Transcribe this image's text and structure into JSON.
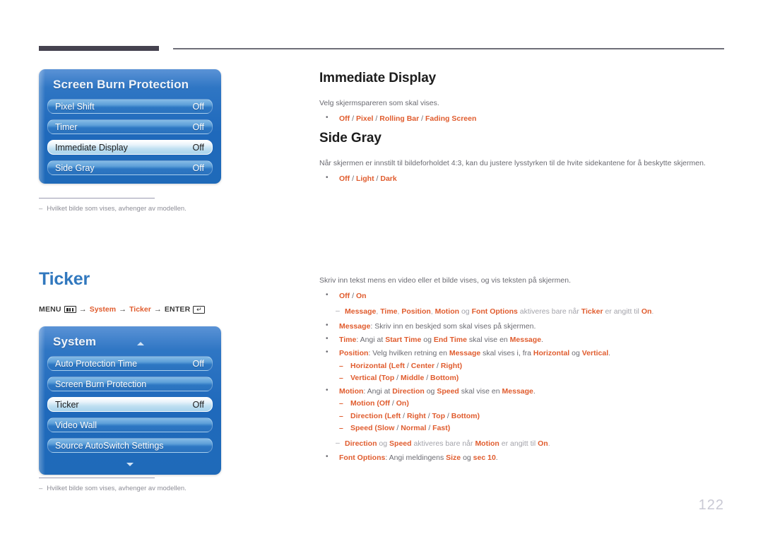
{
  "page": {
    "number": "122"
  },
  "panels": {
    "screen_burn_protection": {
      "title": "Screen Burn Protection",
      "rows": [
        {
          "label": "Pixel Shift",
          "value": "Off",
          "selected": false
        },
        {
          "label": "Timer",
          "value": "Off",
          "selected": false
        },
        {
          "label": "Immediate Display",
          "value": "Off",
          "selected": true
        },
        {
          "label": "Side Gray",
          "value": "Off",
          "selected": false
        }
      ]
    },
    "system": {
      "title": "System",
      "rows": [
        {
          "label": "Auto Protection Time",
          "value": "Off",
          "selected": false
        },
        {
          "label": "Screen Burn Protection",
          "value": "",
          "selected": false
        },
        {
          "label": "Ticker",
          "value": "Off",
          "selected": true
        },
        {
          "label": "Video Wall",
          "value": "",
          "selected": false
        },
        {
          "label": "Source AutoSwitch Settings",
          "value": "",
          "selected": false
        }
      ]
    }
  },
  "footnotes": {
    "one": "Hvilket bilde som vises, avhenger av modellen.",
    "two": "Hvilket bilde som vises, avhenger av modellen.",
    "dash": "–"
  },
  "sections": {
    "immediate_display": {
      "heading": "Immediate Display",
      "description": "Velg skjermspareren som skal vises.",
      "options": {
        "a": "Off",
        "s1": " / ",
        "b": "Pixel",
        "s2": " / ",
        "c": "Rolling Bar",
        "s3": " / ",
        "d": "Fading Screen"
      }
    },
    "side_gray": {
      "heading": "Side Gray",
      "description": "Når skjermen er innstilt til bildeforholdet 4:3, kan du justere lysstyrken til de hvite sidekantene for å beskytte skjermen.",
      "options": {
        "a": "Off",
        "s1": " / ",
        "b": "Light",
        "s2": " / ",
        "c": "Dark"
      }
    },
    "ticker": {
      "heading": "Ticker",
      "breadcrumb": {
        "menu_label": "MENU",
        "menu_icon": "menu-icon",
        "arrow1": "→",
        "crumb1": "System",
        "arrow2": "→",
        "crumb2": "Ticker",
        "arrow3": "→",
        "enter_label": "ENTER",
        "enter_icon": "↵"
      },
      "description": "Skriv inn tekst mens en video eller et bilde vises, og vis teksten på skjermen.",
      "bullets": {
        "b1": {
          "a": "Off",
          "s1": " / ",
          "b": "On"
        },
        "note1": {
          "p1": "Message",
          "p2": ", ",
          "p3": "Time",
          "p4": ", ",
          "p5": "Position",
          "p6": ", ",
          "p7": "Motion",
          "p8": " og ",
          "p9": "Font Options",
          "p10": " aktiveres bare når ",
          "p11": "Ticker",
          "p12": " er angitt til ",
          "p13": "On",
          "p14": "."
        },
        "b2": {
          "a": "Message",
          "b": ": Skriv inn en beskjed som skal vises på skjermen."
        },
        "b3": {
          "a": "Time",
          "b": ": Angi at ",
          "c": "Start Time",
          "d": " og ",
          "e": "End Time",
          "f": " skal vise en ",
          "g": "Message",
          "h": "."
        },
        "b4": {
          "a": "Position",
          "b": ": Velg hvilken retning en ",
          "c": "Message",
          "d": " skal vises i, fra ",
          "e": "Horizontal",
          "f": " og ",
          "g": "Vertical",
          "h": "."
        },
        "b4a": {
          "a": "Horizontal",
          "b": " (",
          "c": "Left",
          "d": " / ",
          "e": "Center",
          "f": " / ",
          "g": "Right",
          "h": ")"
        },
        "b4b": {
          "a": "Vertical",
          "b": " (",
          "c": "Top",
          "d": " / ",
          "e": "Middle",
          "f": " / ",
          "g": "Bottom",
          "h": ")"
        },
        "b5": {
          "a": "Motion",
          "b": ": Angi at ",
          "c": "Direction",
          "d": " og ",
          "e": "Speed",
          "f": " skal vise en ",
          "g": "Message",
          "h": "."
        },
        "b5a": {
          "a": "Motion",
          "b": " (",
          "c": "Off",
          "d": " / ",
          "e": "On",
          "f": ")"
        },
        "b5b": {
          "a": "Direction",
          "b": " (",
          "c": "Left",
          "d": " / ",
          "e": "Right",
          "f": " / ",
          "g": "Top",
          "h": " / ",
          "i": "Bottom",
          "j": ")"
        },
        "b5c": {
          "a": "Speed",
          "b": " (",
          "c": "Slow",
          "d": " / ",
          "e": "Normal",
          "f": " / ",
          "g": "Fast",
          "h": ")"
        },
        "note2": {
          "p1": "Direction",
          "p2": " og ",
          "p3": "Speed",
          "p4": " aktiveres bare når ",
          "p5": "Motion",
          "p6": " er angitt til ",
          "p7": "On",
          "p8": "."
        },
        "b6": {
          "a": "Font Options",
          "b": ": Angi meldingens ",
          "c": "Size",
          "d": " og ",
          "e": "sec 10",
          "f": "."
        }
      }
    }
  },
  "colors": {
    "accent_orange": "#e05c2e",
    "heading_blue": "#3178be",
    "panel_blue": "#1f69bb",
    "body_gray": "#6b6b72"
  }
}
